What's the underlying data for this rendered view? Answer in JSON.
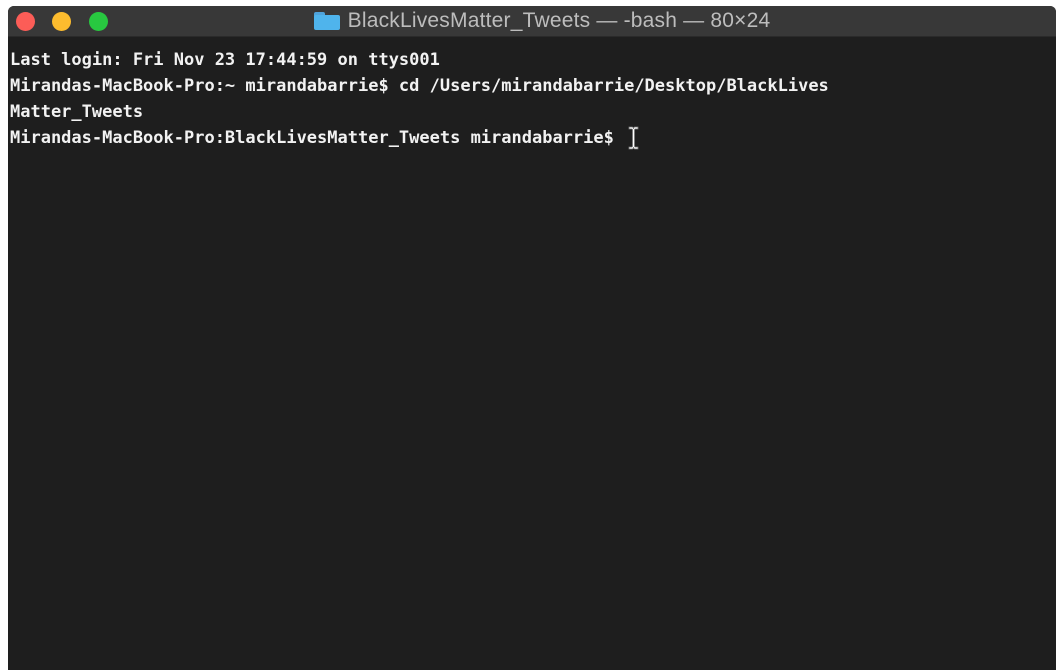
{
  "window": {
    "title": "BlackLivesMatter_Tweets — -bash — 80×24"
  },
  "icons": {
    "folder": "folder-icon",
    "cursor": "ibeam-cursor-icon"
  },
  "colors": {
    "close": "#fc5d57",
    "minimize": "#fdbc2e",
    "zoom": "#28c840",
    "terminal_bg": "#1e1e1e",
    "text": "#f2f2f2"
  },
  "terminal": {
    "lines": [
      "Last login: Fri Nov 23 17:44:59 on ttys001",
      "Mirandas-MacBook-Pro:~ mirandabarrie$ cd /Users/mirandabarrie/Desktop/BlackLives",
      "Matter_Tweets",
      "Mirandas-MacBook-Pro:BlackLivesMatter_Tweets mirandabarrie$ "
    ]
  }
}
